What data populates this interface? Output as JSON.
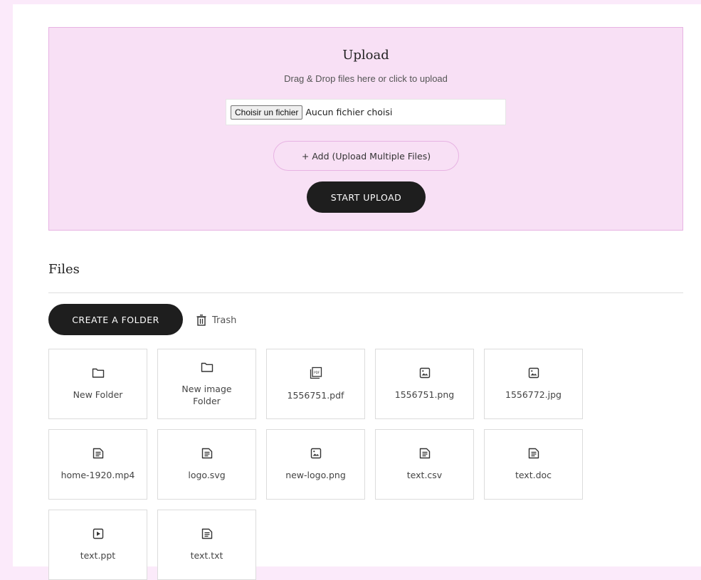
{
  "upload": {
    "title": "Upload",
    "subtitle": "Drag & Drop files here or click to upload",
    "file_button_label": "Choisir un fichier",
    "file_status": "Aucun fichier choisi",
    "add_label": "+ Add (Upload Multiple Files)",
    "start_label": "START UPLOAD"
  },
  "files": {
    "title": "Files",
    "create_folder_label": "CREATE A FOLDER",
    "trash_label": "Trash",
    "items": [
      {
        "name": "New Folder",
        "icon": "folder-icon"
      },
      {
        "name": "New image Folder",
        "icon": "folder-icon"
      },
      {
        "name": "1556751.pdf",
        "icon": "pdf-icon"
      },
      {
        "name": "1556751.png",
        "icon": "image-icon"
      },
      {
        "name": "1556772.jpg",
        "icon": "image-icon"
      },
      {
        "name": "home-1920.mp4",
        "icon": "document-icon"
      },
      {
        "name": "logo.svg",
        "icon": "document-icon"
      },
      {
        "name": "new-logo.png",
        "icon": "image-icon"
      },
      {
        "name": "text.csv",
        "icon": "document-icon"
      },
      {
        "name": "text.doc",
        "icon": "document-icon"
      },
      {
        "name": "text.ppt",
        "icon": "video-icon"
      },
      {
        "name": "text.txt",
        "icon": "document-icon"
      }
    ]
  }
}
